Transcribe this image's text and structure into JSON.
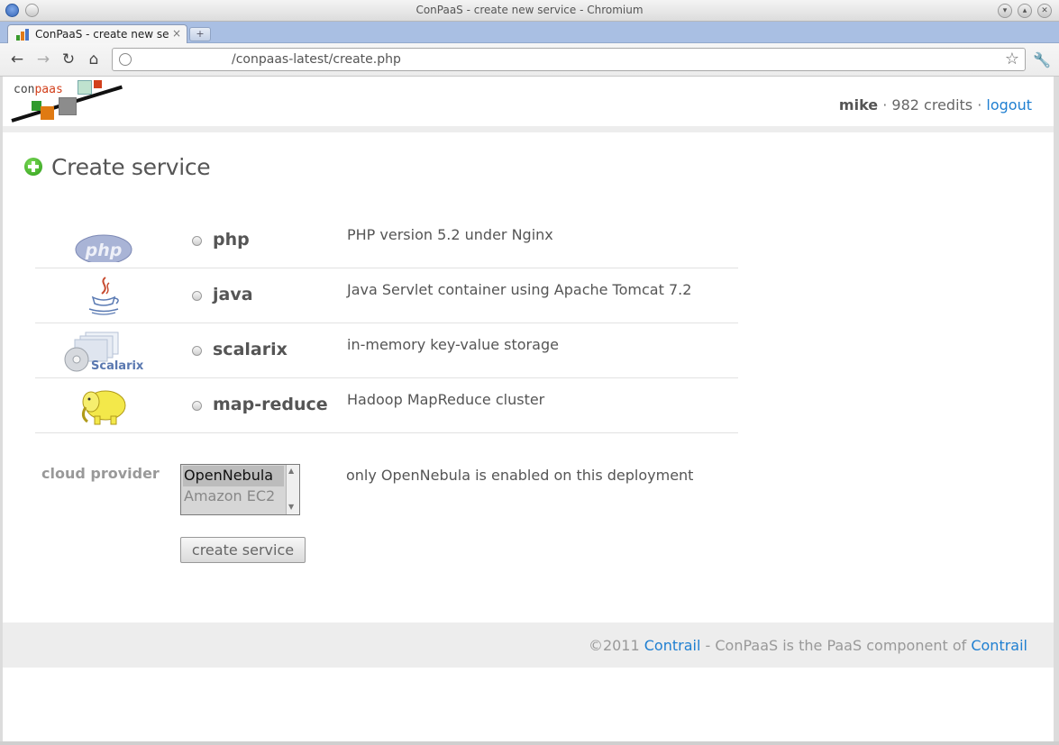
{
  "window": {
    "title": "ConPaaS - create new service - Chromium",
    "tab_label": "ConPaaS - create new service",
    "url_visible": "/conpaas-latest/create.php"
  },
  "header": {
    "logo_text_1": "con",
    "logo_text_2": "paas",
    "username": "mike",
    "credits": "982 credits",
    "sep": "·",
    "logout_label": "logout"
  },
  "main": {
    "heading": "Create service",
    "services": [
      {
        "name": "php",
        "description": "PHP version 5.2 under Nginx",
        "icon": "php-logo-icon"
      },
      {
        "name": "java",
        "description": "Java Servlet container using Apache Tomcat 7.2",
        "icon": "java-logo-icon"
      },
      {
        "name": "scalarix",
        "description": "in-memory key-value storage",
        "icon": "scalarix-logo-icon"
      },
      {
        "name": "map-reduce",
        "description": "Hadoop MapReduce cluster",
        "icon": "hadoop-elephant-icon"
      }
    ],
    "php_logo_text": "php",
    "scalarix_logo_text": "Scalarix",
    "cloud_provider_label": "cloud provider",
    "cloud_provider_options": [
      "OpenNebula",
      "Amazon EC2"
    ],
    "cloud_provider_selected": "OpenNebula",
    "cloud_provider_note": "only OpenNebula is enabled on this deployment",
    "create_button": "create service"
  },
  "footer": {
    "copyright": "©2011",
    "link1": "Contrail",
    "middle": " - ConPaaS is the PaaS component of ",
    "link2": "Contrail"
  },
  "colors": {
    "link": "#1f7fd1",
    "tabstrip": "#a9bfe3",
    "footer_bg": "#ededed",
    "add_icon": "#2a9a16"
  }
}
